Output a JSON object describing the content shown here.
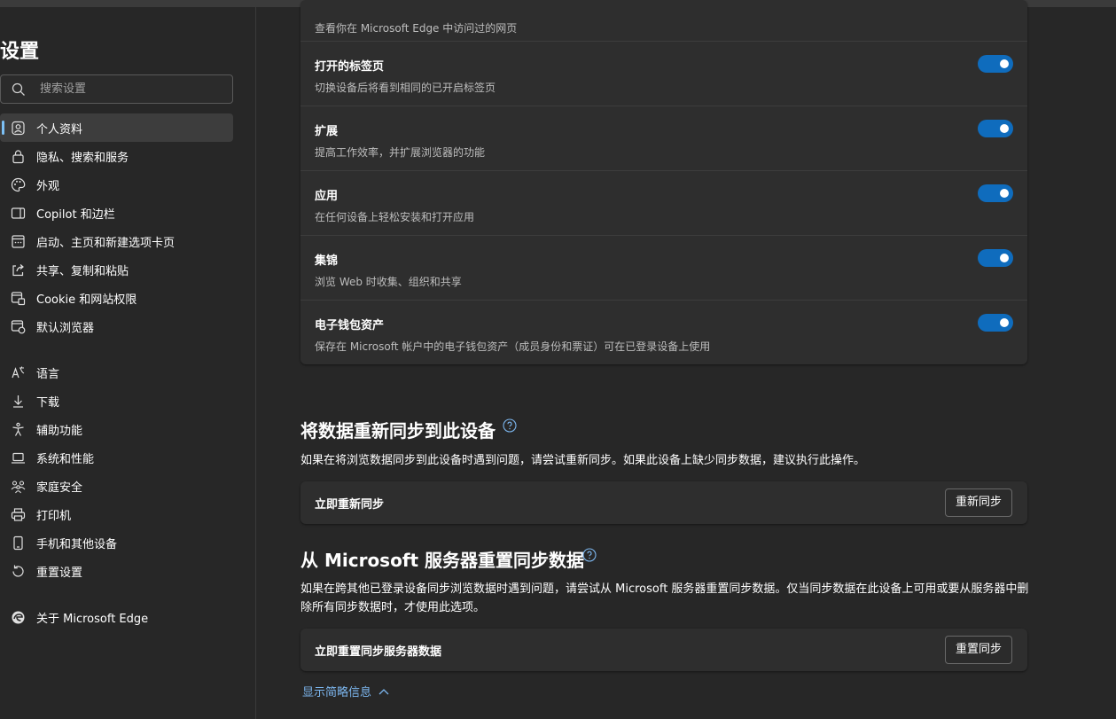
{
  "sidebar": {
    "title": "设置",
    "search_placeholder": "搜索设置",
    "items": [
      {
        "label": "个人资料",
        "icon": "profile-icon"
      },
      {
        "label": "隐私、搜索和服务",
        "icon": "lock-icon"
      },
      {
        "label": "外观",
        "icon": "palette-icon"
      },
      {
        "label": "Copilot 和边栏",
        "icon": "sidebar-icon"
      },
      {
        "label": "启动、主页和新建选项卡页",
        "icon": "home-tabs-icon"
      },
      {
        "label": "共享、复制和粘贴",
        "icon": "share-icon"
      },
      {
        "label": "Cookie 和网站权限",
        "icon": "cookie-icon"
      },
      {
        "label": "默认浏览器",
        "icon": "browser-icon"
      },
      {
        "label": "语言",
        "icon": "language-icon"
      },
      {
        "label": "下载",
        "icon": "download-icon"
      },
      {
        "label": "辅助功能",
        "icon": "accessibility-icon"
      },
      {
        "label": "系统和性能",
        "icon": "laptop-icon"
      },
      {
        "label": "家庭安全",
        "icon": "family-icon"
      },
      {
        "label": "打印机",
        "icon": "printer-icon"
      },
      {
        "label": "手机和其他设备",
        "icon": "phone-icon"
      },
      {
        "label": "重置设置",
        "icon": "reset-icon"
      },
      {
        "label": "关于 Microsoft Edge",
        "icon": "edge-icon"
      }
    ]
  },
  "sync_card": {
    "top_desc": "查看你在 Microsoft Edge 中访问过的网页",
    "rows": [
      {
        "title": "打开的标签页",
        "desc": "切换设备后将看到相同的已开启标签页",
        "enabled": true
      },
      {
        "title": "扩展",
        "desc": "提高工作效率，并扩展浏览器的功能",
        "enabled": true
      },
      {
        "title": "应用",
        "desc": "在任何设备上轻松安装和打开应用",
        "enabled": true
      },
      {
        "title": "集锦",
        "desc": "浏览 Web 时收集、组织和共享",
        "enabled": true
      },
      {
        "title": "电子钱包资产",
        "desc": "保存在 Microsoft 帐户中的电子钱包资产（成员身份和票证）可在已登录设备上使用",
        "enabled": true
      }
    ]
  },
  "resync": {
    "title": "将数据重新同步到此设备",
    "desc": "如果在将浏览数据同步到此设备时遇到问题，请尝试重新同步。如果此设备上缺少同步数据，建议执行此操作。",
    "action_label": "立即重新同步",
    "button": "重新同步"
  },
  "reset_sync": {
    "title": "从 Microsoft 服务器重置同步数据",
    "desc": "如果在跨其他已登录设备同步浏览数据时遇到问题，请尝试从 Microsoft 服务器重置同步数据。仅当同步数据在此设备上可用或要从服务器中删除所有同步数据时，才使用此选项。",
    "action_label": "立即重置同步服务器数据",
    "button": "重置同步"
  },
  "show_less": "显示简略信息",
  "colors": {
    "accent": "#0f6cbd",
    "link": "#7cb6ee",
    "background": "#272727",
    "card": "#2e2e2e"
  }
}
